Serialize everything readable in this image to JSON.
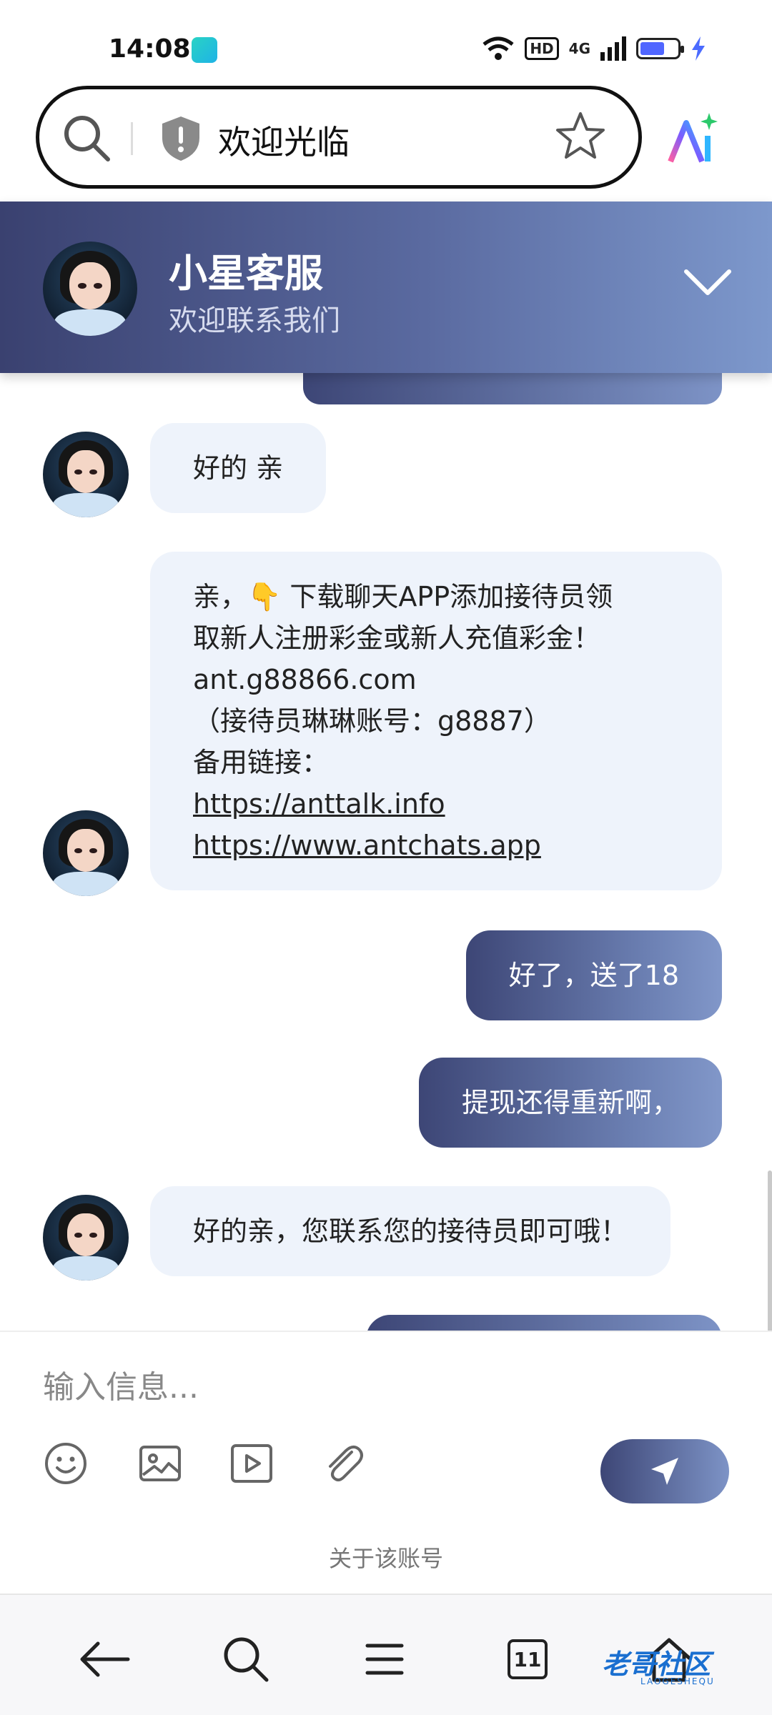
{
  "status_bar": {
    "time": "14:08",
    "hd": "HD",
    "network": "4G",
    "battery_level": 0.65
  },
  "address_bar": {
    "title": "欢迎光临"
  },
  "chat_header": {
    "name": "小星客服",
    "subtitle": "欢迎联系我们"
  },
  "messages": [
    {
      "side": "in",
      "lines": [
        "好的 亲"
      ]
    },
    {
      "side": "in",
      "lines": [
        "亲，👇 下载聊天APP添加接待员领",
        "取新人注册彩金或新人充值彩金！",
        "ant.g88866.com",
        "（接待员琳琳账号：g8887）",
        "备用链接："
      ],
      "links": [
        "https://anttalk.info",
        "https://www.antchats.app"
      ]
    },
    {
      "side": "out",
      "lines": [
        "好了，送了18"
      ]
    },
    {
      "side": "out",
      "lines": [
        "提现还得重新啊，"
      ]
    },
    {
      "side": "in",
      "lines": [
        "好的亲，您联系您的接待员即可哦！"
      ]
    }
  ],
  "input": {
    "placeholder": "输入信息..."
  },
  "about_link": "关于该账号",
  "bottom_nav": {
    "tabs_count": "11"
  },
  "watermark": {
    "text": "老哥社区",
    "sub": "LAOGESHEQU"
  },
  "colors": {
    "header_start": "#3a4170",
    "header_end": "#7d98cc",
    "incoming_bubble": "#eef3fb",
    "accent_ai": "#4d7cfe"
  }
}
